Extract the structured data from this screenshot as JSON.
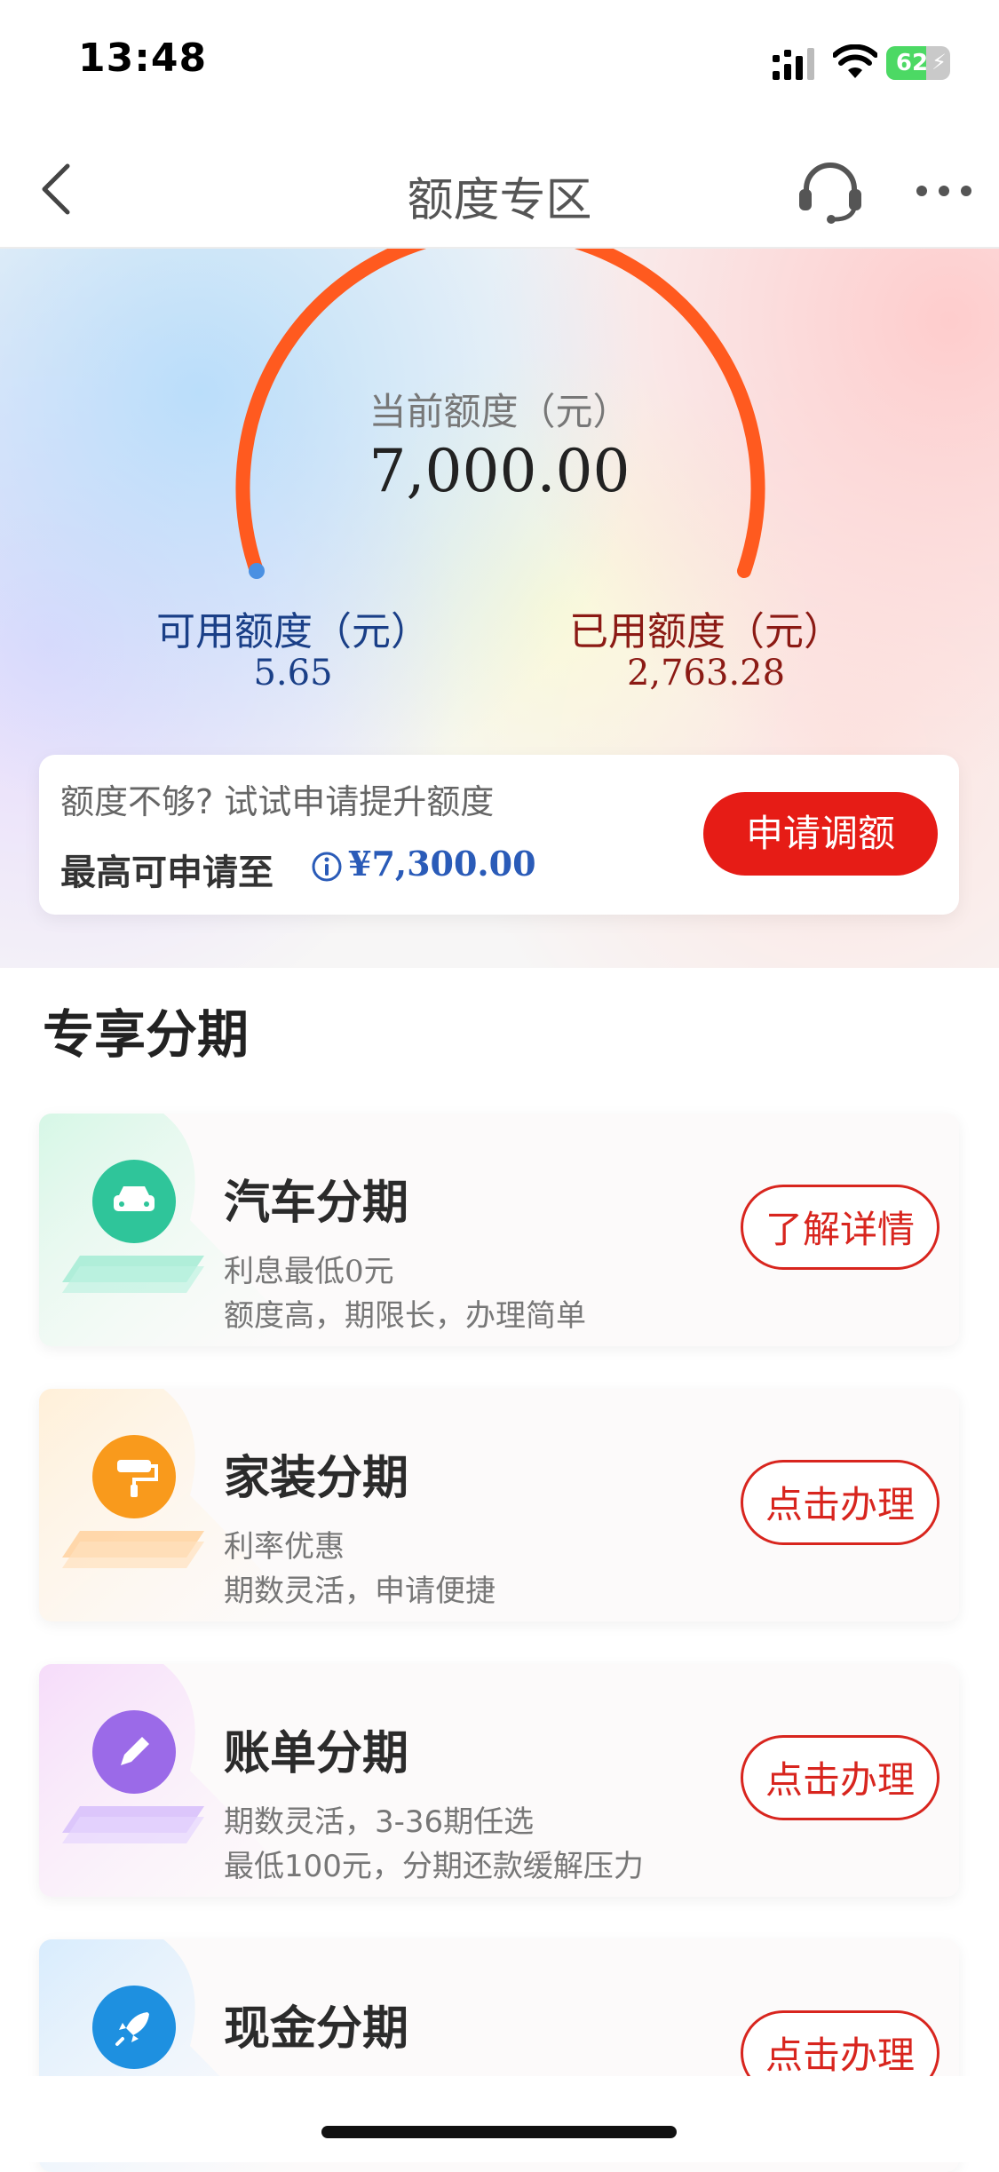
{
  "status_bar": {
    "time": "13:48",
    "battery": "62",
    "battery_level": 0.62
  },
  "nav": {
    "title": "额度专区",
    "back_icon": "chevron-left-icon",
    "service_icon": "headset-icon",
    "more_icon": "more-dots-icon"
  },
  "credit": {
    "current_label": "当前额度（元）",
    "current_value": "7,000.00",
    "available_label": "可用额度（元）",
    "available_value": "5.65",
    "used_label": "已用额度（元）",
    "used_value": "2,763.28"
  },
  "raise": {
    "prompt": "额度不够? 试试申请提升额度",
    "max_label": "最高可申请至",
    "max_value": "¥7,300.00",
    "button": "申请调额"
  },
  "section": {
    "title": "专享分期"
  },
  "cards": [
    {
      "title": "汽车分期",
      "line1": "利息最低0元",
      "line2": "额度高，期限长，办理简单",
      "button": "了解详情",
      "icon": "car-icon",
      "color": "#2fc59a"
    },
    {
      "title": "家装分期",
      "line1": "利率优惠",
      "line2": "期数灵活，申请便捷",
      "button": "点击办理",
      "icon": "paint-roller-icon",
      "color": "#f99a1c"
    },
    {
      "title": "账单分期",
      "line1": "期数灵活，3-36期任选",
      "line2": "最低100元，分期还款缓解压力",
      "button": "点击办理",
      "icon": "pen-icon",
      "color": "#9b6ae8"
    },
    {
      "title": "现金分期",
      "line1": "",
      "line2": "",
      "button": "点击办理",
      "icon": "rocket-icon",
      "color": "#1e90e0"
    }
  ],
  "colors": {
    "accent": "#e61c16",
    "gauge": "#ff5a1f",
    "available": "#1a3f87",
    "used": "#8b1a14"
  }
}
